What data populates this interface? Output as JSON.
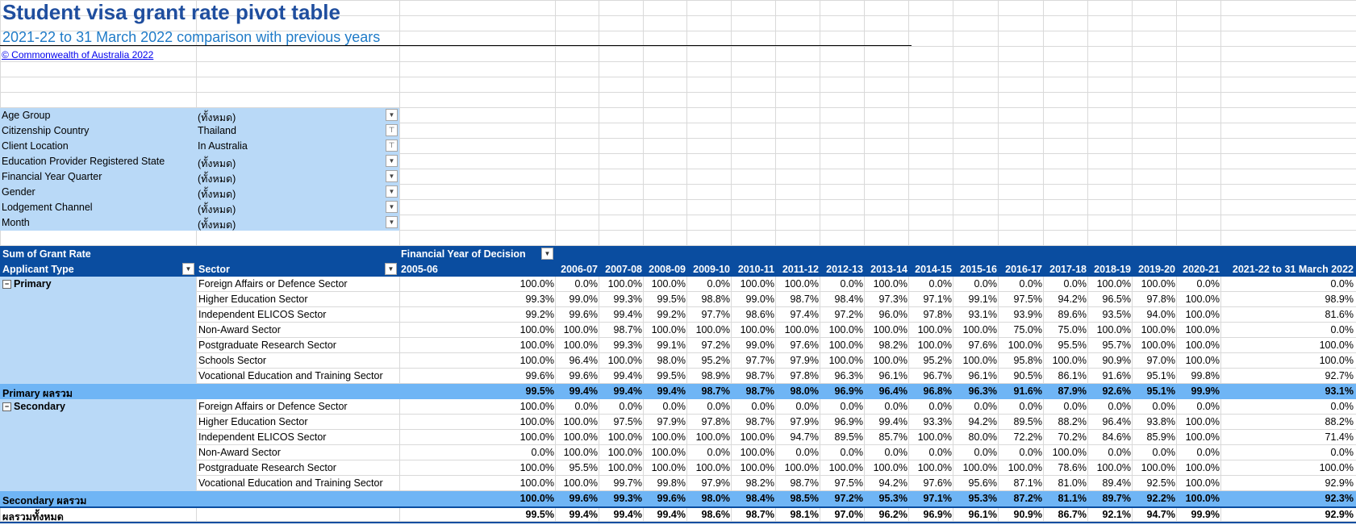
{
  "title": "Student visa grant rate pivot table",
  "subtitle": "2021-22 to 31 March 2022 comparison with previous years",
  "copyright": "© Commonwealth of Australia 2022",
  "filters": [
    {
      "label": "Age Group",
      "value": "(ทั้งหมด)",
      "icon": "dropdown-icon"
    },
    {
      "label": "Citizenship Country",
      "value": "Thailand",
      "icon": "filter-icon"
    },
    {
      "label": "Client Location",
      "value": "In Australia",
      "icon": "filter-icon"
    },
    {
      "label": "Education Provider Registered State",
      "value": "(ทั้งหมด)",
      "icon": "dropdown-icon"
    },
    {
      "label": "Financial Year Quarter",
      "value": "(ทั้งหมด)",
      "icon": "dropdown-icon"
    },
    {
      "label": "Gender",
      "value": "(ทั้งหมด)",
      "icon": "dropdown-icon"
    },
    {
      "label": "Lodgement Channel",
      "value": "(ทั้งหมด)",
      "icon": "dropdown-icon"
    },
    {
      "label": "Month",
      "value": "(ทั้งหมด)",
      "icon": "dropdown-icon"
    }
  ],
  "pivot": {
    "values_label": "Sum of Grant Rate",
    "column_field": "Financial Year of Decision",
    "row_field_1": "Applicant Type",
    "row_field_2": "Sector",
    "years": [
      "2005-06",
      "2006-07",
      "2007-08",
      "2008-09",
      "2009-10",
      "2010-11",
      "2011-12",
      "2012-13",
      "2013-14",
      "2014-15",
      "2015-16",
      "2016-17",
      "2017-18",
      "2018-19",
      "2019-20",
      "2020-21",
      "2021-22 to 31 March 2022"
    ],
    "groups": [
      {
        "name": "Primary",
        "rows": [
          {
            "sector": "Foreign Affairs or Defence Sector",
            "values": [
              "100.0%",
              "0.0%",
              "100.0%",
              "100.0%",
              "0.0%",
              "100.0%",
              "100.0%",
              "0.0%",
              "100.0%",
              "0.0%",
              "0.0%",
              "0.0%",
              "0.0%",
              "100.0%",
              "100.0%",
              "0.0%",
              "0.0%"
            ]
          },
          {
            "sector": "Higher Education Sector",
            "values": [
              "99.3%",
              "99.0%",
              "99.3%",
              "99.5%",
              "98.8%",
              "99.0%",
              "98.7%",
              "98.4%",
              "97.3%",
              "97.1%",
              "99.1%",
              "97.5%",
              "94.2%",
              "96.5%",
              "97.8%",
              "100.0%",
              "98.9%"
            ]
          },
          {
            "sector": "Independent ELICOS Sector",
            "values": [
              "99.2%",
              "99.6%",
              "99.4%",
              "99.2%",
              "97.7%",
              "98.6%",
              "97.4%",
              "97.2%",
              "96.0%",
              "97.8%",
              "93.1%",
              "93.9%",
              "89.6%",
              "93.5%",
              "94.0%",
              "100.0%",
              "81.6%"
            ]
          },
          {
            "sector": "Non-Award Sector",
            "values": [
              "100.0%",
              "100.0%",
              "98.7%",
              "100.0%",
              "100.0%",
              "100.0%",
              "100.0%",
              "100.0%",
              "100.0%",
              "100.0%",
              "100.0%",
              "75.0%",
              "75.0%",
              "100.0%",
              "100.0%",
              "100.0%",
              "0.0%"
            ]
          },
          {
            "sector": "Postgraduate Research Sector",
            "values": [
              "100.0%",
              "100.0%",
              "99.3%",
              "99.1%",
              "97.2%",
              "99.0%",
              "97.6%",
              "100.0%",
              "98.2%",
              "100.0%",
              "97.6%",
              "100.0%",
              "95.5%",
              "95.7%",
              "100.0%",
              "100.0%",
              "100.0%"
            ]
          },
          {
            "sector": "Schools Sector",
            "values": [
              "100.0%",
              "96.4%",
              "100.0%",
              "98.0%",
              "95.2%",
              "97.7%",
              "97.9%",
              "100.0%",
              "100.0%",
              "95.2%",
              "100.0%",
              "95.8%",
              "100.0%",
              "90.9%",
              "97.0%",
              "100.0%",
              "100.0%"
            ]
          },
          {
            "sector": "Vocational Education and Training Sector",
            "values": [
              "99.6%",
              "99.6%",
              "99.4%",
              "99.5%",
              "98.9%",
              "98.7%",
              "97.8%",
              "96.3%",
              "96.1%",
              "96.7%",
              "96.1%",
              "90.5%",
              "86.1%",
              "91.6%",
              "95.1%",
              "99.8%",
              "92.7%"
            ]
          }
        ],
        "total_label": "Primary ผลรวม",
        "total": [
          "99.5%",
          "99.4%",
          "99.4%",
          "99.4%",
          "98.7%",
          "98.7%",
          "98.0%",
          "96.9%",
          "96.4%",
          "96.8%",
          "96.3%",
          "91.6%",
          "87.9%",
          "92.6%",
          "95.1%",
          "99.9%",
          "93.1%"
        ]
      },
      {
        "name": "Secondary",
        "rows": [
          {
            "sector": "Foreign Affairs or Defence Sector",
            "values": [
              "100.0%",
              "0.0%",
              "0.0%",
              "0.0%",
              "0.0%",
              "0.0%",
              "0.0%",
              "0.0%",
              "0.0%",
              "0.0%",
              "0.0%",
              "0.0%",
              "0.0%",
              "0.0%",
              "0.0%",
              "0.0%",
              "0.0%"
            ]
          },
          {
            "sector": "Higher Education Sector",
            "values": [
              "100.0%",
              "100.0%",
              "97.5%",
              "97.9%",
              "97.8%",
              "98.7%",
              "97.9%",
              "96.9%",
              "99.4%",
              "93.3%",
              "94.2%",
              "89.5%",
              "88.2%",
              "96.4%",
              "93.8%",
              "100.0%",
              "88.2%"
            ]
          },
          {
            "sector": "Independent ELICOS Sector",
            "values": [
              "100.0%",
              "100.0%",
              "100.0%",
              "100.0%",
              "100.0%",
              "100.0%",
              "94.7%",
              "89.5%",
              "85.7%",
              "100.0%",
              "80.0%",
              "72.2%",
              "70.2%",
              "84.6%",
              "85.9%",
              "100.0%",
              "71.4%"
            ]
          },
          {
            "sector": "Non-Award Sector",
            "values": [
              "0.0%",
              "100.0%",
              "100.0%",
              "100.0%",
              "0.0%",
              "100.0%",
              "0.0%",
              "0.0%",
              "0.0%",
              "0.0%",
              "0.0%",
              "0.0%",
              "100.0%",
              "0.0%",
              "0.0%",
              "0.0%",
              "0.0%"
            ]
          },
          {
            "sector": "Postgraduate Research Sector",
            "values": [
              "100.0%",
              "95.5%",
              "100.0%",
              "100.0%",
              "100.0%",
              "100.0%",
              "100.0%",
              "100.0%",
              "100.0%",
              "100.0%",
              "100.0%",
              "100.0%",
              "78.6%",
              "100.0%",
              "100.0%",
              "100.0%",
              "100.0%"
            ]
          },
          {
            "sector": "Vocational Education and Training Sector",
            "values": [
              "100.0%",
              "100.0%",
              "99.7%",
              "99.8%",
              "97.9%",
              "98.2%",
              "98.7%",
              "97.5%",
              "94.2%",
              "97.6%",
              "95.6%",
              "87.1%",
              "81.0%",
              "89.4%",
              "92.5%",
              "100.0%",
              "92.9%"
            ]
          }
        ],
        "total_label": "Secondary ผลรวม",
        "total": [
          "100.0%",
          "99.6%",
          "99.3%",
          "99.6%",
          "98.0%",
          "98.4%",
          "98.5%",
          "97.2%",
          "95.3%",
          "97.1%",
          "95.3%",
          "87.2%",
          "81.1%",
          "89.7%",
          "92.2%",
          "100.0%",
          "92.3%"
        ]
      }
    ],
    "grand_total_label": "ผลรวมทั้งหมด",
    "grand_total": [
      "99.5%",
      "99.4%",
      "99.4%",
      "99.4%",
      "98.6%",
      "98.7%",
      "98.1%",
      "97.0%",
      "96.2%",
      "96.9%",
      "96.1%",
      "90.9%",
      "86.7%",
      "92.1%",
      "94.7%",
      "99.9%",
      "92.9%"
    ]
  }
}
